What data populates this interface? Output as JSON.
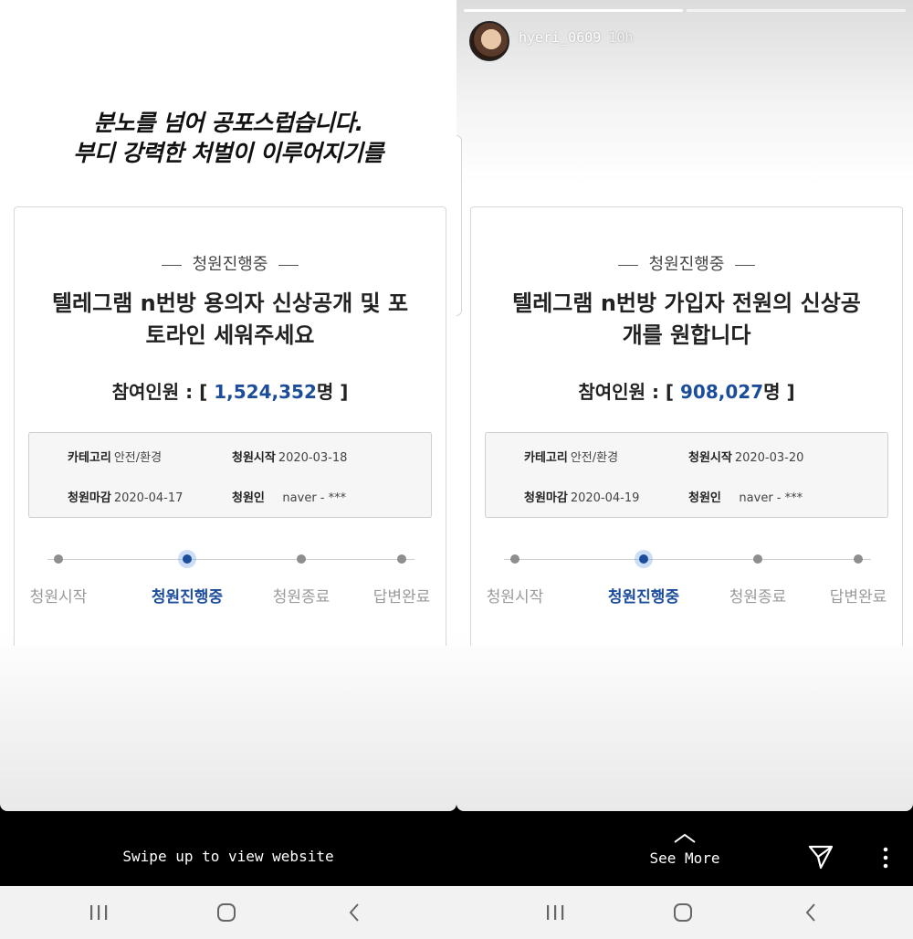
{
  "left": {
    "caption_line1": "분노를 넘어 공포스럽습니다.",
    "caption_line2": "부디 강력한 처벌이 이루어지기를",
    "status": "청원진행중",
    "title_line1": "텔레그램 n번방 용의자 신상공개 및 포",
    "title_line2": "토라인 세워주세요",
    "participants_label": "참여인원 : [",
    "participants_count": "1,524,352",
    "participants_suffix": "명 ]",
    "info": {
      "category_label": "카테고리",
      "category_value": "안전/환경",
      "start_label": "청원시작",
      "start_value": "2020-03-18",
      "end_label": "청원마감",
      "end_value": "2020-04-17",
      "petitioner_label": "청원인",
      "petitioner_value": "naver - ***"
    },
    "steps": [
      "청원시작",
      "청원진행중",
      "청원종료",
      "답변완료"
    ],
    "active_step": 1,
    "swipe_text": "Swipe up to view website"
  },
  "right": {
    "username": "hyeri_0609",
    "time": "10h",
    "status": "청원진행중",
    "title_line1": "텔레그램 n번방 가입자 전원의 신상공",
    "title_line2": "개를 원합니다",
    "participants_label": "참여인원 : [",
    "participants_count": "908,027",
    "participants_suffix": "명 ]",
    "info": {
      "category_label": "카테고리",
      "category_value": "안전/환경",
      "start_label": "청원시작",
      "start_value": "2020-03-20",
      "end_label": "청원마감",
      "end_value": "2020-04-19",
      "petitioner_label": "청원인",
      "petitioner_value": "naver - ***"
    },
    "steps": [
      "청원시작",
      "청원진행중",
      "청원종료",
      "답변완료"
    ],
    "active_step": 1,
    "see_more": "See More",
    "icons": {
      "send": "send-icon",
      "more": "more-vertical-icon"
    }
  },
  "nav": {
    "icons": [
      "recent-apps-icon",
      "home-icon",
      "back-icon"
    ]
  },
  "colors": {
    "accent": "#1c4d9b",
    "muted": "#9a9a9a"
  }
}
